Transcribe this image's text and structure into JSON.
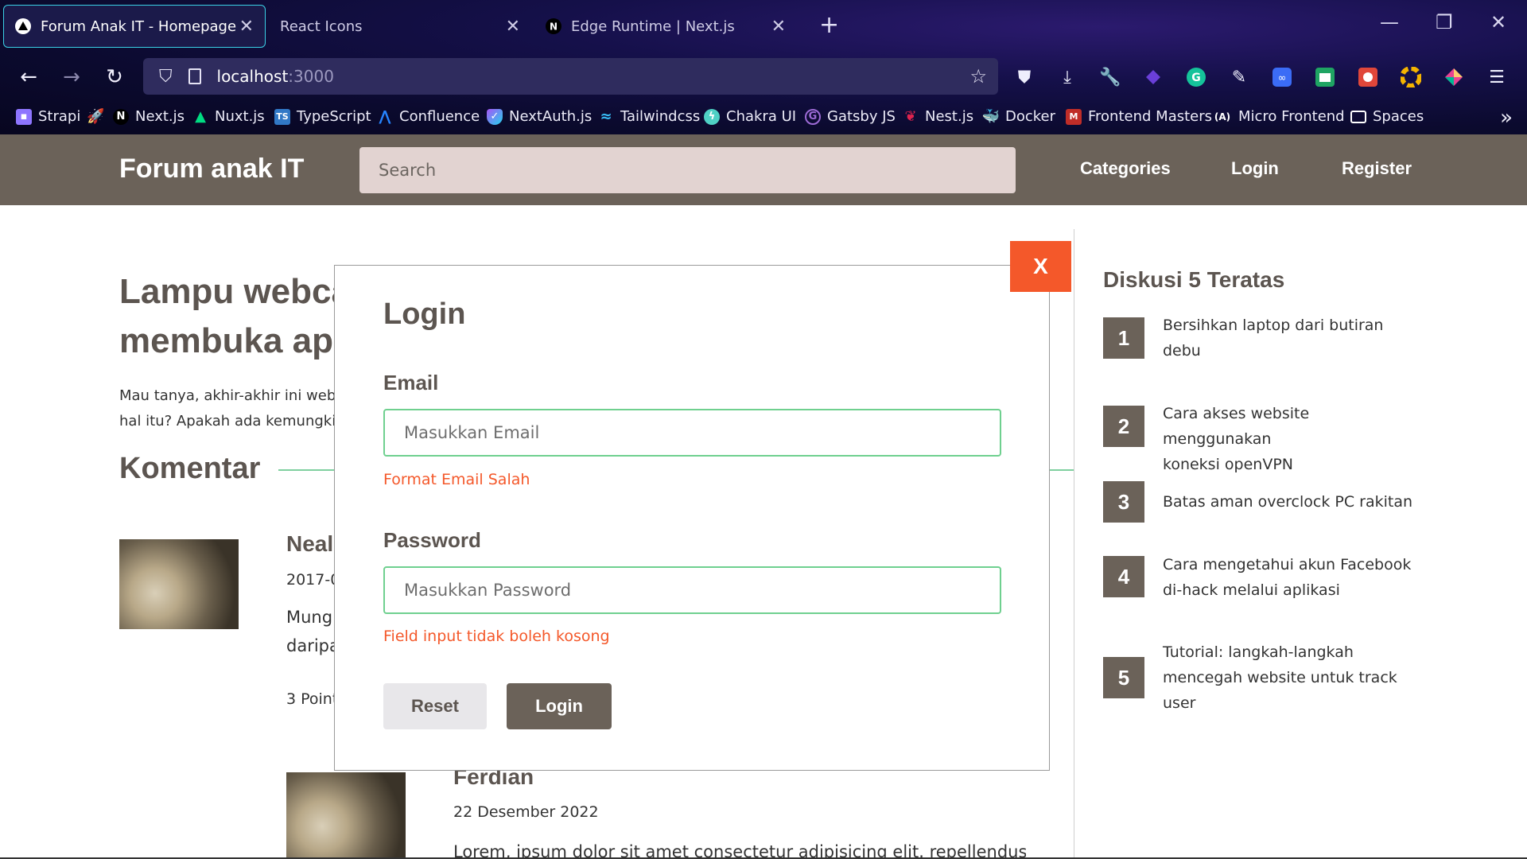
{
  "browser": {
    "tabs": [
      {
        "title": "Forum Anak IT - Homepage",
        "favicon": "triangle-icon",
        "active": true
      },
      {
        "title": "React Icons",
        "favicon": "",
        "active": false
      },
      {
        "title": "Edge Runtime | Next.js",
        "favicon": "nextjs-icon",
        "active": false
      }
    ],
    "url_host": "localhost",
    "url_port": ":3000",
    "bookmarks": [
      {
        "label": "Strapi",
        "icon": "strapi-icon",
        "color": "#8e75ff"
      },
      {
        "label": "Next.js",
        "icon": "nextjs-icon",
        "color": "#000000"
      },
      {
        "label": "Nuxt.js",
        "icon": "nuxt-icon",
        "color": "#00dc82"
      },
      {
        "label": "TypeScript",
        "icon": "typescript-icon",
        "color": "#3178c6"
      },
      {
        "label": "Confluence",
        "icon": "confluence-icon",
        "color": "#2684ff"
      },
      {
        "label": "NextAuth.js",
        "icon": "nextauth-icon",
        "color": "#a855f7"
      },
      {
        "label": "Tailwindcss",
        "icon": "tailwind-icon",
        "color": "#38bdf8"
      },
      {
        "label": "Chakra UI",
        "icon": "chakra-icon",
        "color": "#4fd1c5"
      },
      {
        "label": "Gatsby JS",
        "icon": "gatsby-icon",
        "color": "#663399"
      },
      {
        "label": "Nest.js",
        "icon": "nestjs-icon",
        "color": "#e0234e"
      },
      {
        "label": "Docker",
        "icon": "docker-icon",
        "color": "#2496ed"
      },
      {
        "label": "Frontend Masters",
        "icon": "frontend-masters-icon",
        "color": "#c02d28"
      },
      {
        "label": "Micro Frontend",
        "icon": "micro-frontend-icon",
        "color": "#ffffff"
      },
      {
        "label": "Spaces",
        "icon": "folder-icon",
        "color": "#ffffff"
      }
    ]
  },
  "header": {
    "brand": "Forum anak IT",
    "search_placeholder": "Search",
    "nav": [
      "Categories",
      "Login",
      "Register"
    ]
  },
  "post": {
    "title_line1": "Lampu webca",
    "title_line2": "membuka apl",
    "body_line1": "Mau tanya, akhir-akhir ini web",
    "body_line2": "hal itu? Apakah ada kemungki"
  },
  "comments_heading": "Komentar",
  "comments": [
    {
      "name": "Neal",
      "date": "2017-0",
      "text_line1": "Mungl",
      "text_line2": "daripa",
      "points": "3 Point"
    },
    {
      "name": "Ferdian",
      "date": "22 Desember 2022",
      "text_line1": "Lorem, ipsum dolor sit amet consectetur adipisicing elit. repellendus."
    }
  ],
  "sidebar": {
    "title": "Diskusi 5 Teratas",
    "items": [
      {
        "rank": "1",
        "line1": "Bersihkan laptop dari butiran",
        "line2": "debu",
        "line3": ""
      },
      {
        "rank": "2",
        "line1": "Cara akses website menggunakan",
        "line2": "koneksi openVPN",
        "line3": ""
      },
      {
        "rank": "3",
        "line1": "Batas aman overclock PC rakitan",
        "line2": "",
        "line3": ""
      },
      {
        "rank": "4",
        "line1": "Cara mengetahui akun Facebook",
        "line2": "di-hack melalui aplikasi",
        "line3": ""
      },
      {
        "rank": "5",
        "line1": "Tutorial: langkah-langkah",
        "line2": "mencegah website untuk track",
        "line3": "user"
      }
    ]
  },
  "modal": {
    "close_label": "X",
    "title": "Login",
    "email_label": "Email",
    "email_placeholder": "Masukkan Email",
    "email_value": "",
    "email_error": "Format Email Salah",
    "password_label": "Password",
    "password_placeholder": "Masukkan Password",
    "password_value": "",
    "password_error": "Field input tidak boleh kosong",
    "reset_label": "Reset",
    "login_label": "Login"
  },
  "colors": {
    "accent": "#6b6259",
    "error": "#f4582a",
    "input_border": "#6fd08f"
  }
}
